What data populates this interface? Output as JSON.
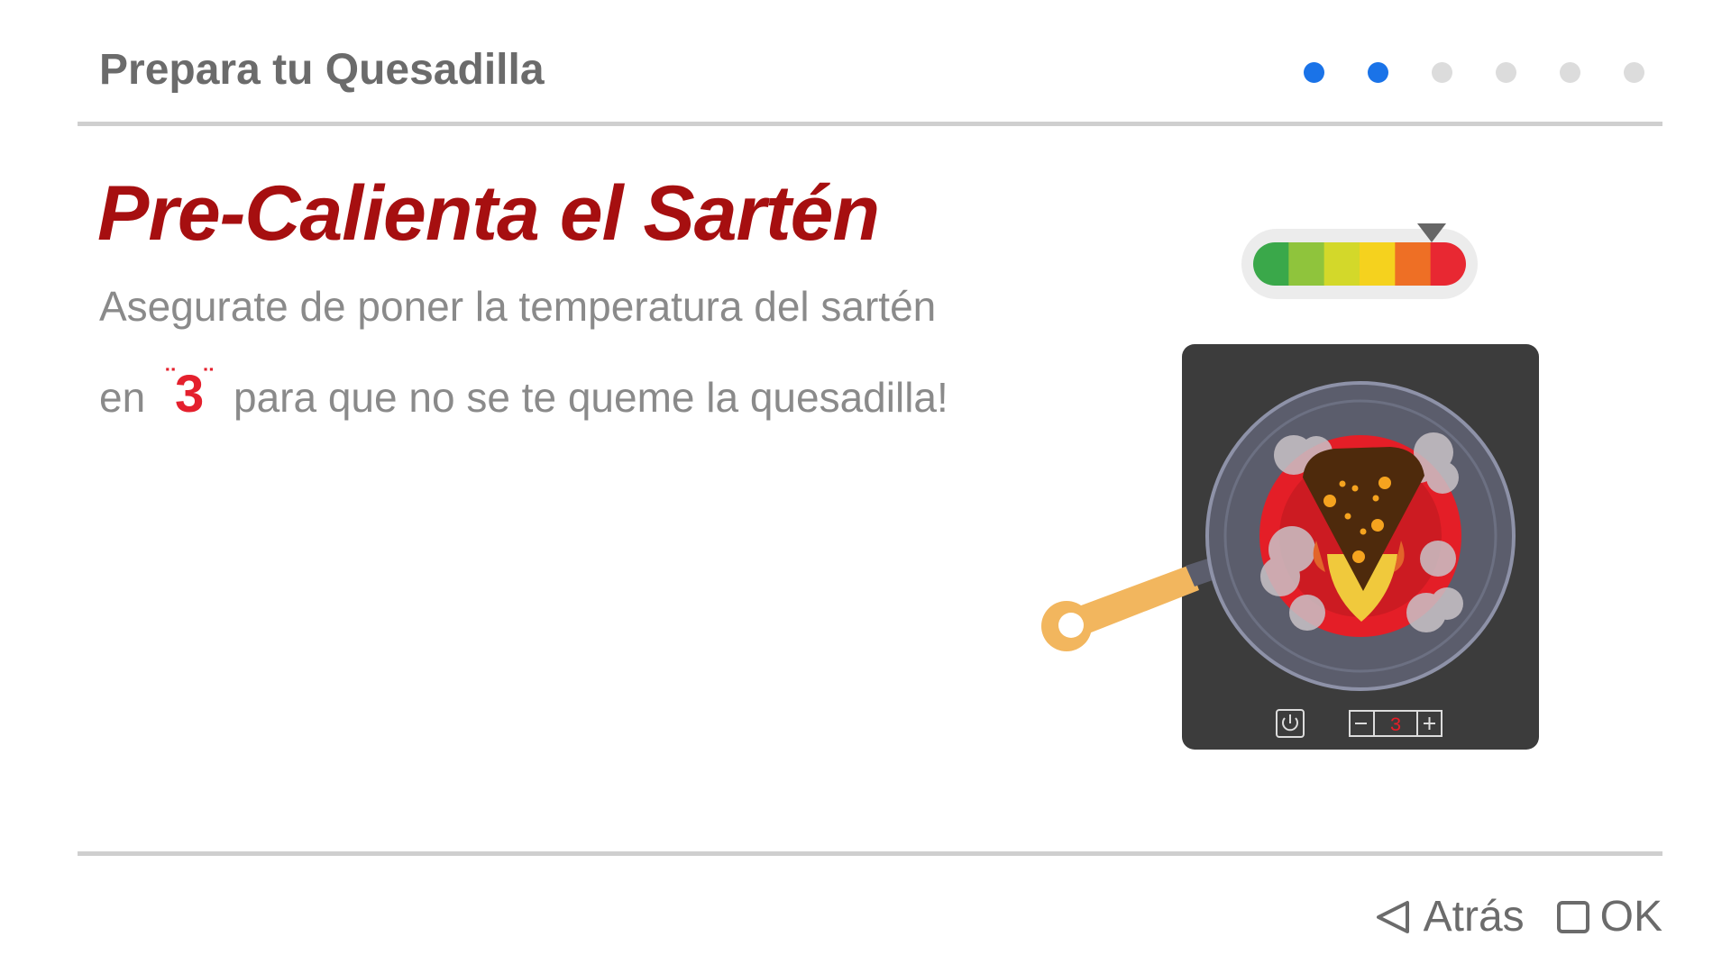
{
  "header": {
    "title": "Prepara tu Quesadilla"
  },
  "progress": {
    "total_steps": 6,
    "current_step": 2
  },
  "step": {
    "title": "Pre-Calienta el Sartén",
    "description_line1": "Asegurate de poner la temperatura del sartén",
    "description_pre": "en",
    "highlight_value": "3",
    "description_post": "para que no se te queme la quesadilla!"
  },
  "heat_gauge": {
    "level": 3,
    "colors": [
      "#3aa84a",
      "#8fc43c",
      "#d3d82a",
      "#f5d21e",
      "#ee6f25",
      "#e82832"
    ]
  },
  "stove": {
    "display_value": "3",
    "power_icon": "power-icon",
    "minus_icon": "minus-icon",
    "plus_icon": "plus-icon"
  },
  "footer": {
    "back_label": "Atrás",
    "ok_label": "OK"
  },
  "colors": {
    "accent": "#1a73e8",
    "title": "#a60f10",
    "highlight": "#e4202d",
    "stove": "#3c3c3c",
    "handle": "#f2b65e"
  }
}
